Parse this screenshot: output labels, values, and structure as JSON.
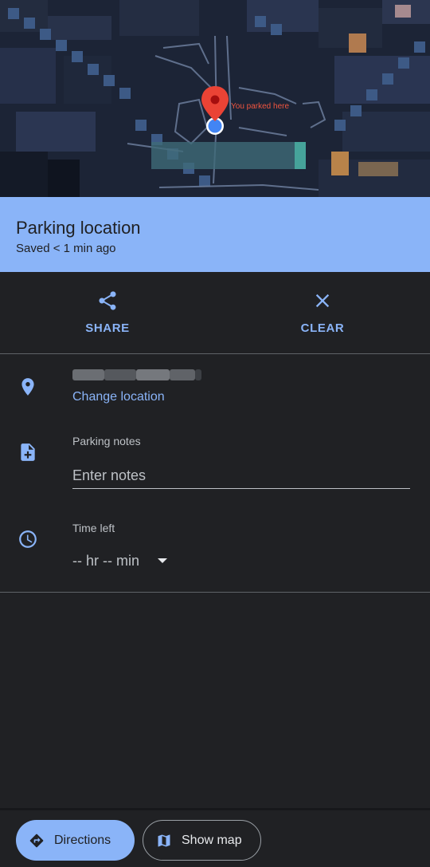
{
  "map": {
    "marker_label": "You parked here",
    "colors": {
      "marker": "#ea4335",
      "location_dot": "#4285f4"
    }
  },
  "header": {
    "title": "Parking location",
    "subtitle": "Saved < 1 min ago",
    "background": "#8ab4f8"
  },
  "actions": {
    "share": {
      "label": "SHARE",
      "icon": "share-icon"
    },
    "clear": {
      "label": "CLEAR",
      "icon": "close-icon"
    }
  },
  "location": {
    "icon": "location-pin-icon",
    "change_label": "Change location"
  },
  "notes": {
    "icon": "note-add-icon",
    "label": "Parking notes",
    "placeholder": "Enter notes",
    "value": ""
  },
  "time_left": {
    "icon": "clock-icon",
    "label": "Time left",
    "value": "-- hr -- min"
  },
  "bottom": {
    "directions_label": "Directions",
    "show_map_label": "Show map"
  },
  "colors": {
    "accent": "#8ab4f8",
    "background": "#202124",
    "divider": "#5f6368"
  }
}
